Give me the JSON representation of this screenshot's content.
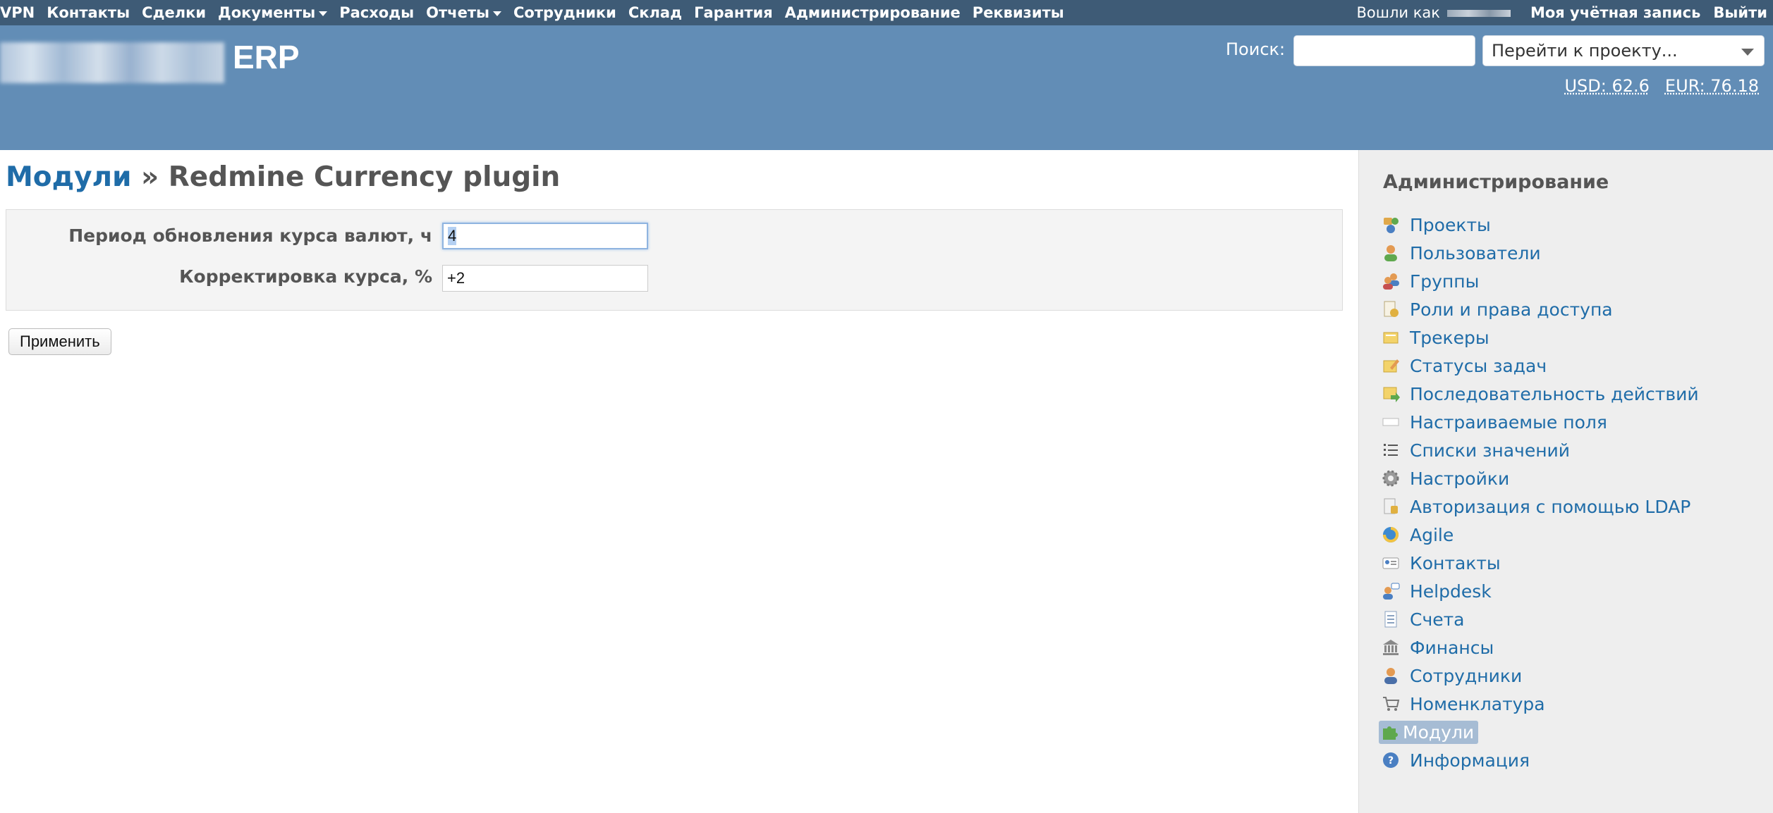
{
  "top_menu": {
    "items": [
      "VPN",
      "Контакты",
      "Сделки",
      "Документы",
      "Расходы",
      "Отчеты",
      "Сотрудники",
      "Склад",
      "Гарантия",
      "Администрирование",
      "Реквизиты"
    ],
    "logged_as": "Вошли как",
    "my_account": "Моя учётная запись",
    "logout": "Выйти"
  },
  "header": {
    "site_name": "ERP",
    "search_label": "Поиск:",
    "search_value": "",
    "project_jump": "Перейти к проекту...",
    "rates": {
      "usd": "USD: 62.6",
      "eur": "EUR: 76.18"
    }
  },
  "page": {
    "breadcrumb_link": "Модули",
    "separator": "»",
    "title": "Redmine Currency plugin",
    "fields": {
      "period_label": "Период обновления курса валют, ч",
      "period_value": "4",
      "correction_label": "Корректировка курса, %",
      "correction_value": "+2"
    },
    "apply_button": "Применить"
  },
  "sidebar": {
    "title": "Администрирование",
    "items": [
      {
        "label": "Проекты",
        "icon": "projects-icon"
      },
      {
        "label": "Пользователи",
        "icon": "user-icon"
      },
      {
        "label": "Группы",
        "icon": "group-icon"
      },
      {
        "label": "Роли и права доступа",
        "icon": "roles-icon"
      },
      {
        "label": "Трекеры",
        "icon": "tracker-icon"
      },
      {
        "label": "Статусы задач",
        "icon": "status-icon"
      },
      {
        "label": "Последовательность действий",
        "icon": "workflow-icon"
      },
      {
        "label": "Настраиваемые поля",
        "icon": "custom-fields-icon"
      },
      {
        "label": "Списки значений",
        "icon": "list-icon"
      },
      {
        "label": "Настройки",
        "icon": "gear-icon"
      },
      {
        "label": "Авторизация с помощью LDAP",
        "icon": "ldap-icon"
      },
      {
        "label": "Agile",
        "icon": "agile-icon"
      },
      {
        "label": "Контакты",
        "icon": "contacts-icon"
      },
      {
        "label": "Helpdesk",
        "icon": "helpdesk-icon"
      },
      {
        "label": "Счета",
        "icon": "invoice-icon"
      },
      {
        "label": "Финансы",
        "icon": "bank-icon"
      },
      {
        "label": "Сотрудники",
        "icon": "employee-icon"
      },
      {
        "label": "Номенклатура",
        "icon": "cart-icon"
      },
      {
        "label": "Модули",
        "icon": "plugin-icon"
      },
      {
        "label": "Информация",
        "icon": "info-icon"
      }
    ],
    "selected": "Модули"
  },
  "colors": {
    "top_menu_bg": "#3e5b76",
    "header_bg": "#628db6",
    "link": "#1f6ca8",
    "sidebar_bg": "#eeeeee",
    "selected_bg": "#a6bcd4"
  }
}
